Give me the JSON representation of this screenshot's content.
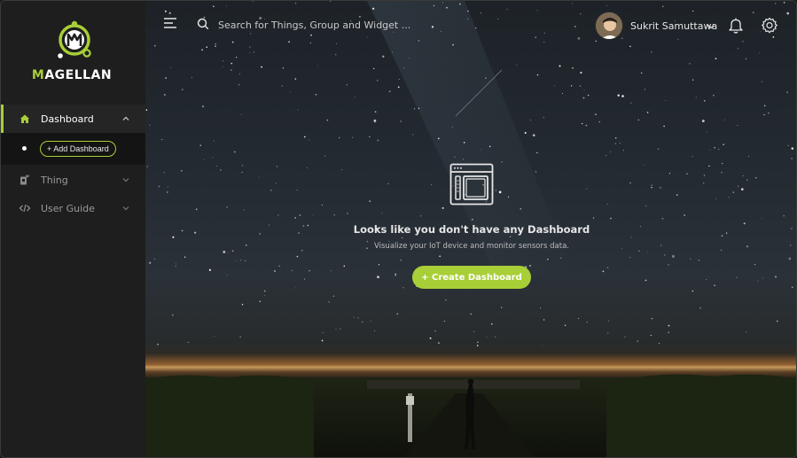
{
  "brand": {
    "name_prefix": "M",
    "name_rest": "AGELLAN",
    "accent_color": "#a8cf37"
  },
  "sidebar": {
    "items": [
      {
        "label": "Dashboard",
        "icon": "home-icon",
        "active": true,
        "expanded": true
      },
      {
        "label": "Thing",
        "icon": "thing-icon",
        "active": false,
        "expanded": false
      },
      {
        "label": "User Guide",
        "icon": "code-icon",
        "active": false,
        "expanded": false
      }
    ],
    "sub": {
      "add_label": "+ Add Dashboard"
    }
  },
  "topbar": {
    "search_placeholder": "Search for Things, Group and Widget ...",
    "user_name": "Sukrit Samuttawa",
    "icons": [
      "menu-icon",
      "search-icon",
      "chevron-down-icon",
      "bell-icon",
      "gear-icon"
    ]
  },
  "empty_state": {
    "icon": "dashboard-window-icon",
    "title": "Looks like you don't have any Dashboard",
    "subtitle": "Visualize your IoT device and monitor sensors data.",
    "button_label": "+ Create Dashboard"
  }
}
